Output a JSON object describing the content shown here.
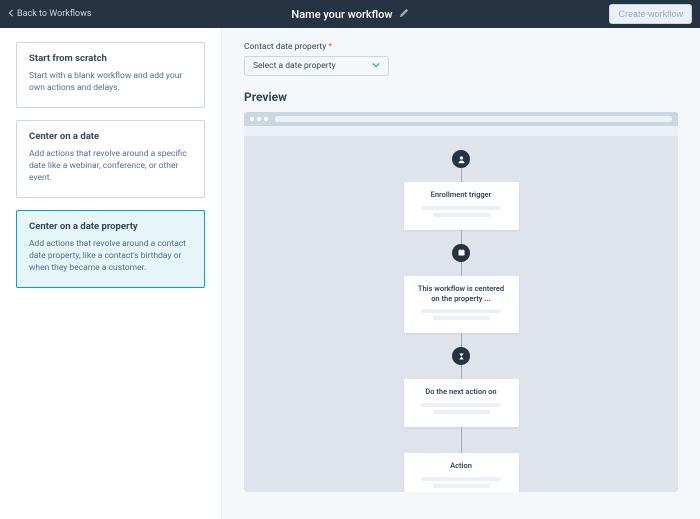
{
  "header": {
    "back_label": "Back to Workflows",
    "title": "Name your workflow",
    "create_label": "Create workflow"
  },
  "sidebar": {
    "cards": [
      {
        "title": "Start from scratch",
        "desc": "Start with a blank workflow and add your own actions and delays."
      },
      {
        "title": "Center on a date",
        "desc": "Add actions that revolve around a specific date like a webinar, conference, or other event."
      },
      {
        "title": "Center on a date property",
        "desc": "Add actions that revolve around a contact date property, like a contact's birthday or when they became a customer."
      }
    ]
  },
  "form": {
    "property_label": "Contact date property",
    "required_mark": "*",
    "select_placeholder": "Select a date property"
  },
  "preview": {
    "heading": "Preview",
    "nodes": {
      "trigger": "Enrollment trigger",
      "center": "This workflow is centered on the property ...",
      "delay": "Do the next action on",
      "action": "Action"
    }
  }
}
